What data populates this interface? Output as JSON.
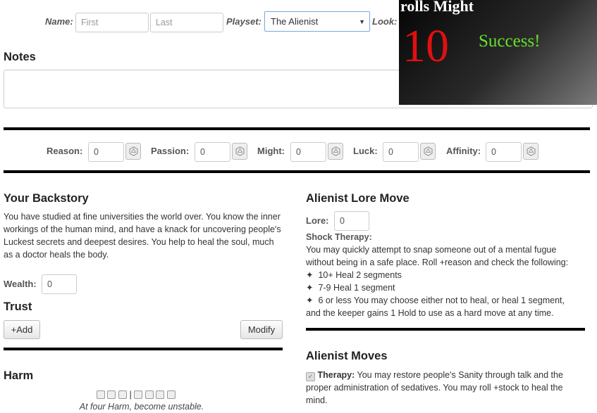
{
  "header": {
    "name_label": "Name:",
    "first_placeholder": "First",
    "last_placeholder": "Last",
    "playset_label": "Playset:",
    "playset_value": "The Alienist",
    "look_label": "Look:"
  },
  "notes": {
    "title": "Notes",
    "value": ""
  },
  "stats": [
    {
      "label": "Reason:",
      "value": "0"
    },
    {
      "label": "Passion:",
      "value": "0"
    },
    {
      "label": "Might:",
      "value": "0"
    },
    {
      "label": "Luck:",
      "value": "0"
    },
    {
      "label": "Affinity:",
      "value": "0"
    }
  ],
  "backstory": {
    "title": "Your Backstory",
    "text": "You have studied at fine universities the world over. You know the inner workings of the human mind, and have a knack for uncovering people's Luckest secrets and deepest desires. You help to heal the soul, much as a doctor heals the body."
  },
  "wealth": {
    "label": "Wealth:",
    "value": "0"
  },
  "trust": {
    "title": "Trust",
    "add_label": "+Add",
    "modify_label": "Modify"
  },
  "harm": {
    "title": "Harm",
    "caption": "At four Harm, become unstable.",
    "separator": "|"
  },
  "lore_move": {
    "title": "Alienist Lore Move",
    "lore_label": "Lore:",
    "lore_value": "0",
    "shock_title": "Shock Therapy:",
    "shock_text": "You may quickly attempt to snap someone out of a mental fugue without being in a safe place. Roll +reason and check the following:",
    "outcomes": [
      "10+ Heal 2 segments",
      "7-9 Heal 1 segment",
      "6 or less You may choose either not to heal, or heal 1 segment,"
    ],
    "continuation": "and the keeper gains 1 Hold to use as a hard move at any time.",
    "bullet": "✦"
  },
  "moves": {
    "title": "Alienist Moves",
    "therapy_name": "Therapy:",
    "therapy_text": "You may restore people's Sanity through talk and the proper administration of sedatives. You may roll +stock to heal the mind.",
    "therapy_checked": true
  },
  "roll_popup": {
    "heading": "rolls Might",
    "result": "10",
    "outcome": "Success!",
    "colors": {
      "heading": "#ffffff",
      "result": "#e01010",
      "outcome": "#66e02a"
    }
  }
}
